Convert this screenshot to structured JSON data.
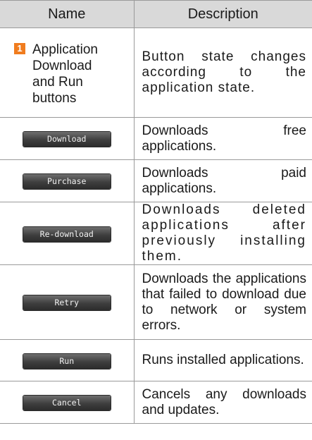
{
  "header": {
    "name": "Name",
    "description": "Description"
  },
  "first_row": {
    "badge": "1",
    "name_lines": [
      "Application",
      "Download",
      "and Run",
      "buttons"
    ],
    "description": "Button state changes according to the application state."
  },
  "rows": [
    {
      "button": "Download",
      "description": "Downloads free applications."
    },
    {
      "button": "Purchase",
      "description": "Downloads paid applications."
    },
    {
      "button": "Re-download",
      "description": "Downloads deleted applications after previously installing them."
    },
    {
      "button": "Retry",
      "description": "Downloads the applications that failed to download due to network or system errors."
    },
    {
      "button": "Run",
      "description": "Runs installed applications."
    },
    {
      "button": "Cancel",
      "description": "Cancels any downloads and updates."
    }
  ],
  "colors": {
    "header_bg": "#d9d9d9",
    "badge": "#f07c1e",
    "button_bg": "#3e3e3e"
  }
}
